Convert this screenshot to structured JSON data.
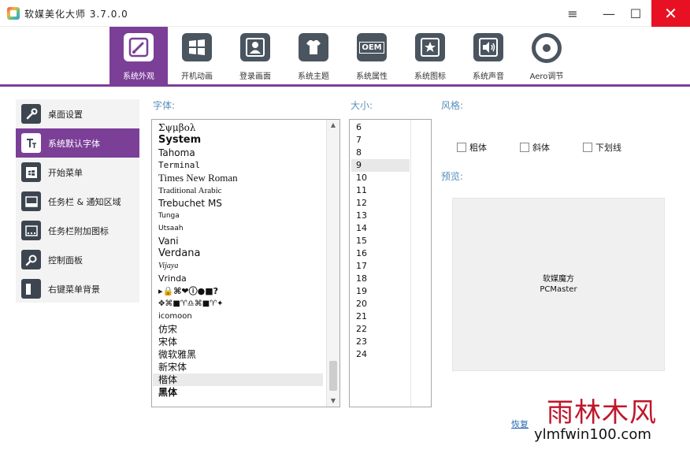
{
  "window": {
    "title": "软媒美化大师 3.7.0.0",
    "controls": {
      "menu": "≡",
      "minimize": "—",
      "maximize": "☐",
      "close": "✕"
    }
  },
  "toolbar": {
    "tabs": [
      {
        "label": "系统外观",
        "icon": "paintbrush-icon",
        "active": true
      },
      {
        "label": "开机动画",
        "icon": "windows-icon"
      },
      {
        "label": "登录画面",
        "icon": "user-icon"
      },
      {
        "label": "系统主题",
        "icon": "tshirt-icon"
      },
      {
        "label": "系统属性",
        "icon": "oem-icon",
        "icon_text": "OEM"
      },
      {
        "label": "系统图标",
        "icon": "star-icon"
      },
      {
        "label": "系统声音",
        "icon": "speaker-icon"
      },
      {
        "label": "Aero调节",
        "icon": "aero-ring-icon"
      }
    ]
  },
  "sidebar": {
    "items": [
      {
        "label": "桌面设置",
        "icon": "wrench-icon"
      },
      {
        "label": "系统默认字体",
        "icon": "font-icon",
        "active": true
      },
      {
        "label": "开始菜单",
        "icon": "start-menu-icon"
      },
      {
        "label": "任务栏 & 通知区域",
        "icon": "taskbar-icon"
      },
      {
        "label": "任务栏附加图标",
        "icon": "tray-icon"
      },
      {
        "label": "控制面板",
        "icon": "magnifier-icon"
      },
      {
        "label": "右键菜单背景",
        "icon": "context-menu-icon"
      }
    ]
  },
  "labels": {
    "font": "字体:",
    "size": "大小:",
    "style": "风格:",
    "preview": "预览:"
  },
  "fonts": [
    "Σψμβολ",
    "System",
    "Tahoma",
    "Terminal",
    "Times New Roman",
    "Traditional Arabic",
    "Trebuchet MS",
    "Tunga",
    "Utsaah",
    "Vani",
    "Verdana",
    "Vijaya",
    "Vrinda",
    "▸🔒⌘❤ⓘ●■?",
    "✥⌘■♈♎⌘■♈✦",
    "icomoon",
    "仿宋",
    "宋体",
    "微软雅黑",
    "新宋体",
    "楷体",
    "黑体"
  ],
  "selected_font": "楷体",
  "sizes": [
    "6",
    "7",
    "8",
    "9",
    "10",
    "11",
    "12",
    "13",
    "14",
    "15",
    "16",
    "17",
    "18",
    "19",
    "20",
    "21",
    "22",
    "23",
    "24"
  ],
  "selected_size": "9",
  "styles": {
    "bold": "粗体",
    "italic": "斜体",
    "underline": "下划线"
  },
  "preview": {
    "line1": "软媒魔方",
    "line2": "PCMaster"
  },
  "restore_link": "恢复",
  "watermark": {
    "brand": "雨林木风",
    "url": "ylmfwin100.com"
  },
  "colors": {
    "accent": "#7b3f98",
    "icon": "#4a5560",
    "close": "#e81123",
    "label": "#5a8fb8"
  }
}
